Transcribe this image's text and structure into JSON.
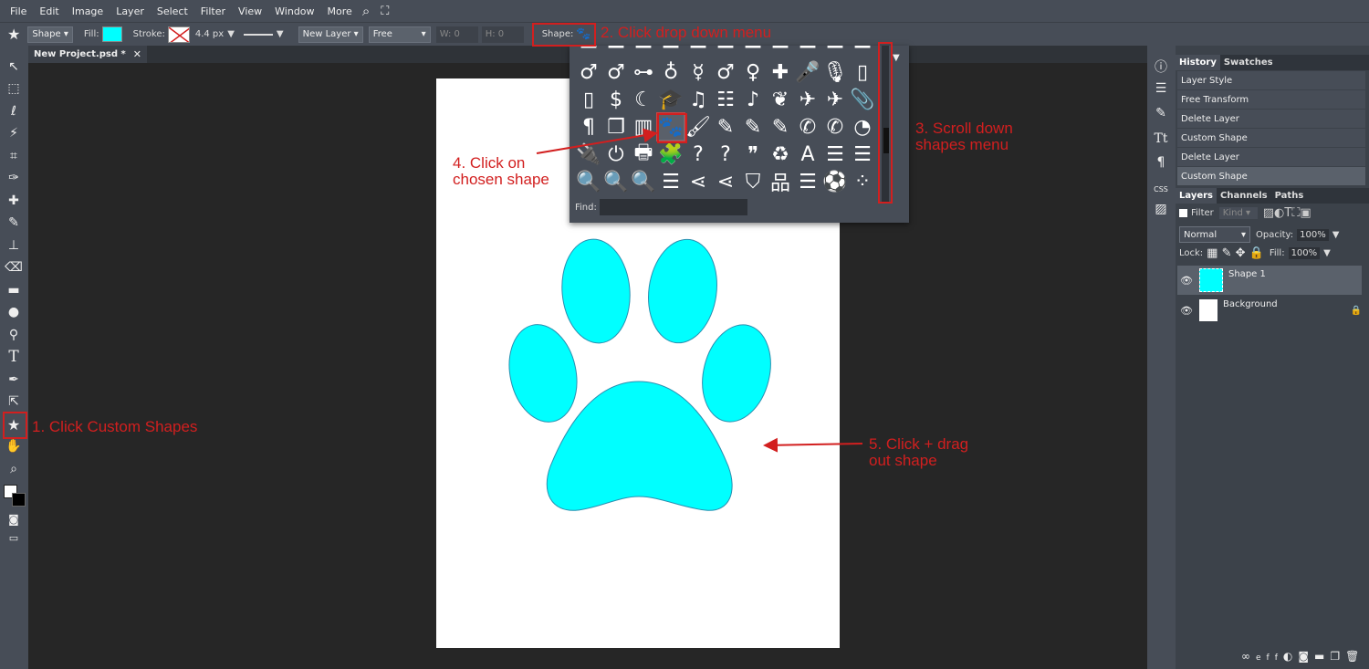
{
  "menu": [
    "File",
    "Edit",
    "Image",
    "Layer",
    "Select",
    "Filter",
    "View",
    "Window",
    "More"
  ],
  "options": {
    "tool_mode": "Shape",
    "fill_label": "Fill:",
    "fill_color": "#00ffff",
    "stroke_label": "Stroke:",
    "stroke_width": "4.4 px",
    "layer_mode": "New Layer",
    "constraint": "Free",
    "w_label": "W:",
    "w_value": "0",
    "h_label": "H:",
    "h_value": "0",
    "shape_label": "Shape:"
  },
  "tab": {
    "title": "New Project.psd *"
  },
  "shapes_dropdown": {
    "find_label": "Find:",
    "rows": [
      [
        "♂",
        "♂",
        "⊶",
        "♁",
        "☿",
        "♂",
        "♀",
        "✚",
        "🎤",
        "🎙",
        "▯"
      ],
      [
        "▯",
        "$",
        "☾",
        "🎓",
        "♫",
        "☷",
        "♪",
        "❦",
        "✈",
        "✈",
        "📎"
      ],
      [
        "¶",
        "❐",
        "▥",
        "🐾",
        "🖌",
        "✎",
        "✎",
        "✎",
        "✆",
        "✆",
        "◔"
      ],
      [
        "🔌",
        "⏻",
        "🖶",
        "🧩",
        "?",
        "?",
        "❞",
        "♻",
        "A",
        "☰",
        "☰"
      ],
      [
        "🔍",
        "🔍",
        "🔍",
        "☰",
        "⋖",
        "⋖",
        "⛉",
        "品",
        "☰",
        "⚽",
        "⁘"
      ]
    ],
    "selected_index": 3
  },
  "history": {
    "tabs": [
      "History",
      "Swatches"
    ],
    "items": [
      "Layer Style",
      "Free Transform",
      "Delete Layer",
      "Custom Shape",
      "Delete Layer",
      "Custom Shape"
    ]
  },
  "layers": {
    "tabs": [
      "Layers",
      "Channels",
      "Paths"
    ],
    "filter_label": "Filter",
    "kind_label": "Kind",
    "blend_mode": "Normal",
    "opacity_label": "Opacity:",
    "opacity_value": "100%",
    "lock_label": "Lock:",
    "fill_label": "Fill:",
    "fill_value": "100%",
    "items": [
      {
        "name": "Shape 1"
      },
      {
        "name": "Background"
      }
    ]
  },
  "annotations": {
    "step1": "1. Click Custom Shapes",
    "step2": "2. Click drop down menu",
    "step3": "3. Scroll down\nshapes menu",
    "step4": "4. Click on\nchosen shape",
    "step5": "5. Click + drag\nout shape",
    "color": "#d21f1f"
  },
  "icons": [
    "star-icon",
    "paw-icon",
    "search-icon",
    "fullscreen-icon",
    "eye-icon",
    "lock-icon"
  ]
}
